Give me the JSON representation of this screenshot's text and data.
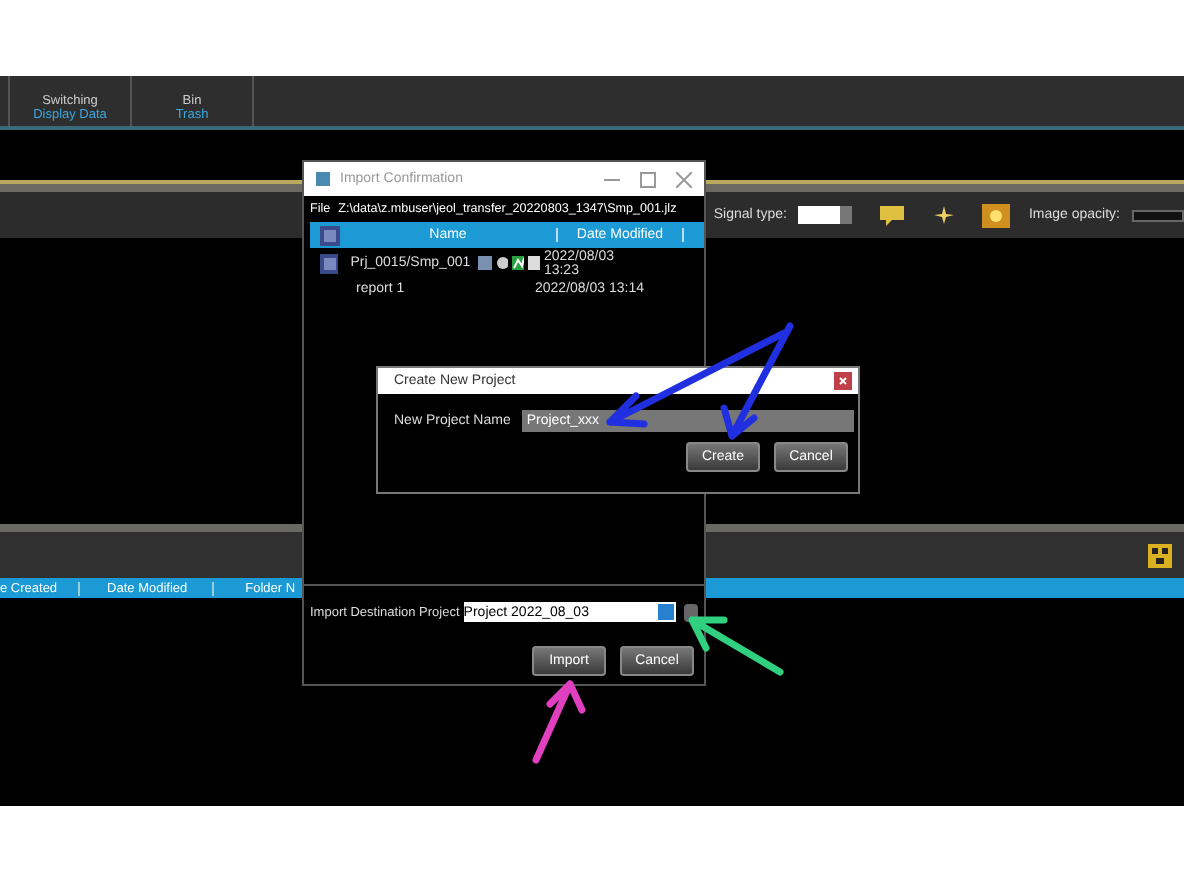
{
  "ribbon": {
    "groups": [
      {
        "label": "Switching",
        "caption": "Display Data"
      },
      {
        "label": "Bin",
        "caption": "Trash"
      }
    ]
  },
  "toolbar": {
    "signal_type_label": "Signal type:",
    "image_opacity_label": "Image opacity:"
  },
  "file_list": {
    "columns": [
      "e Created",
      "Date Modified",
      "Folder N"
    ]
  },
  "import_confirmation": {
    "title": "Import Confirmation",
    "file_label": "File",
    "file_path": "Z:\\data\\z.mbuser\\jeol_transfer_20220803_1347\\Smp_001.jlz",
    "columns": [
      "Name",
      "Date Modified"
    ],
    "rows": [
      {
        "name": "Prj_0015/Smp_001",
        "date": "2022/08/03 13:23",
        "children": [
          {
            "name": "report 1",
            "date": "2022/08/03 13:14"
          }
        ]
      }
    ],
    "destination_label": "Import Destination Project",
    "destination_value": "Project 2022_08_03",
    "buttons": [
      "Import",
      "Cancel"
    ]
  },
  "create_new_project": {
    "title": "Create New Project",
    "name_label": "New Project Name",
    "name_value": "Project_xxx",
    "buttons": [
      "Create",
      "Cancel"
    ]
  }
}
